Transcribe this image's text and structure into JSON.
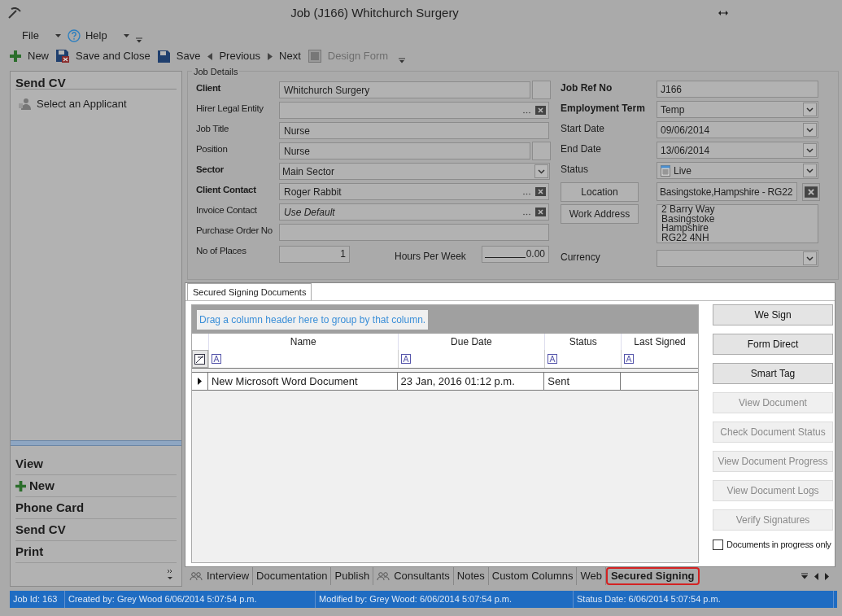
{
  "window": {
    "title": "Job (J166) Whitchurch Surgery"
  },
  "menu": [
    {
      "label": "File",
      "kind": "plain"
    },
    {
      "label": "Help",
      "kind": "help"
    }
  ],
  "toolbar": [
    {
      "label": "New",
      "kind": "new",
      "disabled": false
    },
    {
      "label": "Save and Close",
      "kind": "save_close",
      "disabled": false
    },
    {
      "label": "Save",
      "kind": "save",
      "disabled": false
    },
    {
      "label": "Previous",
      "kind": "previous",
      "disabled": false
    },
    {
      "label": "Next",
      "kind": "next",
      "disabled": false
    },
    {
      "label": "Design Form",
      "kind": "design",
      "disabled": true
    }
  ],
  "side_panel": {
    "title": "Send CV",
    "items": [
      {
        "label": "Select an Applicant"
      }
    ],
    "sections": [
      {
        "label": "View",
        "kind": "plain"
      },
      {
        "label": "New",
        "kind": "new"
      },
      {
        "label": "Phone Card",
        "kind": "plain"
      },
      {
        "label": "Send CV",
        "kind": "plain"
      },
      {
        "label": "Print",
        "kind": "plain"
      }
    ]
  },
  "job_details": {
    "title": "Job Details",
    "left_fields": [
      {
        "label": "Client",
        "bold": true,
        "kind": "text_extra",
        "value": "Whitchurch Surgery"
      },
      {
        "label": "Hirer Legal Entity",
        "bold": false,
        "kind": "lookup"
      },
      {
        "label": "Job Title",
        "bold": false,
        "kind": "text",
        "value": "Nurse"
      },
      {
        "label": "Position",
        "bold": false,
        "kind": "text_extra",
        "value": "Nurse"
      },
      {
        "label": "Sector",
        "bold": true,
        "kind": "select",
        "value": "Main Sector"
      },
      {
        "label": "Client Contact",
        "bold": true,
        "kind": "lookup",
        "value": "Roger Rabbit"
      },
      {
        "label": "Invoice Contact",
        "bold": false,
        "kind": "lookup",
        "value": "Use Default",
        "italic": true
      },
      {
        "label": "Purchase Order No",
        "bold": false,
        "kind": "text"
      },
      {
        "label": "No of Places",
        "bold": false,
        "kind": "pair",
        "value": "1",
        "second_label": "Hours Per Week",
        "second_value": "0.00"
      }
    ],
    "right_fields": [
      {
        "label": "Job Ref No",
        "bold": true,
        "kind": "text",
        "value": "J166"
      },
      {
        "label": "Employment Term",
        "bold": true,
        "kind": "select",
        "value": "Temp"
      },
      {
        "label": "Start Date",
        "bold": false,
        "kind": "select",
        "value": "09/06/2014"
      },
      {
        "label": "End Date",
        "bold": false,
        "kind": "select",
        "value": "13/06/2014"
      },
      {
        "label": "Status",
        "bold": false,
        "kind": "select_icon",
        "value": "Live"
      },
      {
        "label": "Location",
        "bold": false,
        "kind": "button_clear",
        "value": "Basingstoke,Hampshire - RG22"
      },
      {
        "label": "Work Address",
        "bold": false,
        "kind": "button_multiline",
        "lines": [
          "2 Barry Way",
          "Basingstoke",
          "Hampshire",
          "RG22 4NH"
        ]
      },
      {
        "label": "Currency",
        "bold": false,
        "kind": "select"
      }
    ]
  },
  "documents": {
    "tab": "Secured Signing Documents",
    "group_hint": "Drag a column header here to group by that column.",
    "columns": [
      "Name",
      "Due Date",
      "Status",
      "Last Signed"
    ],
    "rows": [
      {
        "name": "New Microsoft Word Document",
        "due_date": "23 Jan, 2016 01:12 p.m.",
        "status": "Sent",
        "current": true
      }
    ],
    "buttons": [
      {
        "label": "We Sign",
        "disabled": false
      },
      {
        "label": "Form Direct",
        "disabled": false
      },
      {
        "label": "Smart Tag",
        "disabled": false
      },
      {
        "label": "View Document",
        "disabled": true
      },
      {
        "label": "Check Document Status",
        "disabled": true
      },
      {
        "label": "View Document Progress",
        "disabled": true
      },
      {
        "label": "View Document Logs",
        "disabled": true
      },
      {
        "label": "Verify Signatures",
        "disabled": true
      }
    ],
    "checkbox": {
      "label": "Documents in progress only",
      "checked": false
    }
  },
  "bottom_tabs": [
    {
      "label": "Interview",
      "kind": "people",
      "selected": false
    },
    {
      "label": "Documentation",
      "kind": "plain",
      "selected": false
    },
    {
      "label": "Publish",
      "kind": "plain",
      "selected": false
    },
    {
      "label": "Consultants",
      "kind": "people",
      "selected": false
    },
    {
      "label": "Notes",
      "kind": "plain",
      "selected": false
    },
    {
      "label": "Custom Columns",
      "kind": "plain",
      "selected": false
    },
    {
      "label": "Web",
      "kind": "plain",
      "selected": false
    },
    {
      "label": "Secured Signing",
      "kind": "plain",
      "selected": true
    }
  ],
  "status_bar": [
    "Job Id: 163",
    "Created by: Grey Wood 6/06/2014 5:07:54 p.m.",
    "Modified by: Grey Wood: 6/06/2014 5:07:54 p.m.",
    "Status Date: 6/06/2014 5:07:54 p.m."
  ]
}
